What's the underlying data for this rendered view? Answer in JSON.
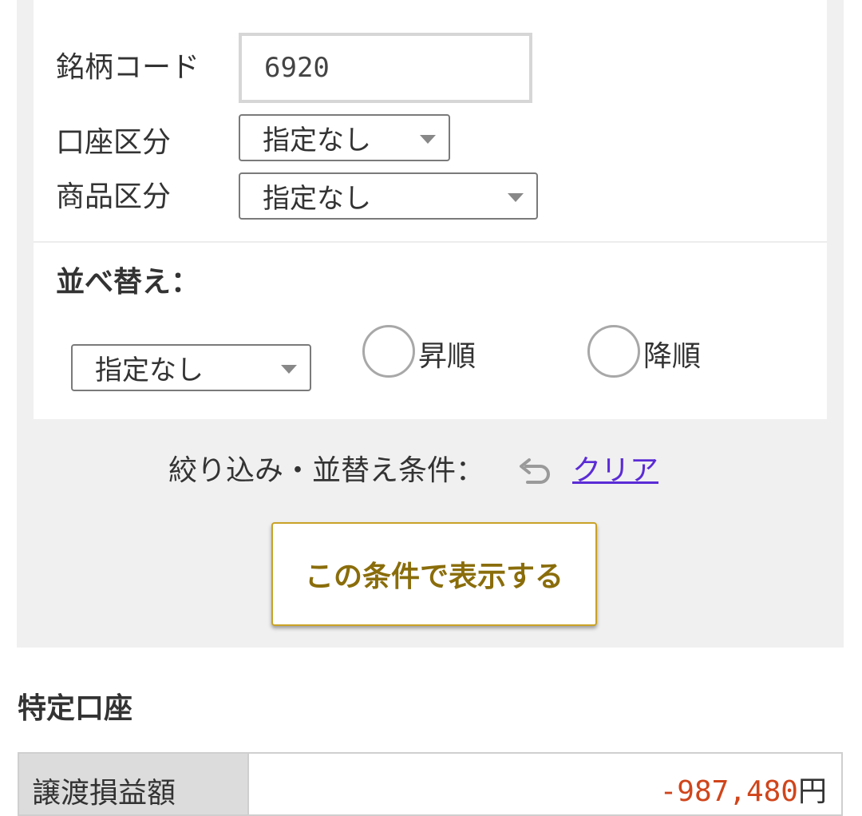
{
  "filter": {
    "code_label": "銘柄コード",
    "code_value": "6920",
    "account_label": "口座区分",
    "account_selected": "指定なし",
    "product_label": "商品区分",
    "product_selected": "指定なし"
  },
  "sort": {
    "title": "並べ替え：",
    "selected": "指定なし",
    "ascending_label": "昇順",
    "descending_label": "降順"
  },
  "conditions": {
    "label": "絞り込み・並替え条件：",
    "clear_label": "クリア",
    "undo_icon": "undo-icon"
  },
  "submit": {
    "label": "この条件で表示する"
  },
  "account_section": {
    "title": "特定口座",
    "rows": [
      {
        "label": "譲渡損益額",
        "value": "-987,480",
        "unit": "円"
      }
    ]
  },
  "colors": {
    "accent_gold": "#c9a227",
    "button_text": "#8a6d0b",
    "link": "#5b2bd6",
    "negative_value": "#d0451b",
    "panel_bg": "#f0f0f0"
  }
}
